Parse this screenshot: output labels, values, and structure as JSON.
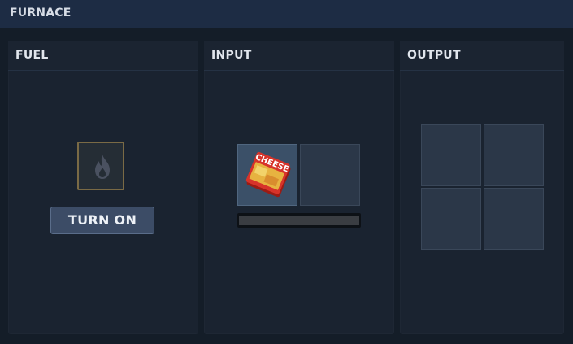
{
  "window": {
    "title": "FURNACE"
  },
  "panels": {
    "fuel": {
      "title": "FUEL",
      "slot_icon": "flame-icon",
      "button_label": "TURN ON"
    },
    "input": {
      "title": "INPUT",
      "slots": [
        {
          "item": "CHEESE",
          "icon": "cheese-box-icon"
        },
        {
          "item": ""
        }
      ],
      "progress": 0
    },
    "output": {
      "title": "OUTPUT",
      "slots": [
        {
          "item": ""
        },
        {
          "item": ""
        },
        {
          "item": ""
        },
        {
          "item": ""
        }
      ]
    }
  },
  "colors": {
    "title_bar": "#1d2c44",
    "panel_bg": "#1a2330",
    "slot_bg": "#2b3748",
    "fuel_slot_border": "#7a6a45",
    "button_bg": "#3c4c66",
    "progress_fill": "#c63b2f"
  }
}
